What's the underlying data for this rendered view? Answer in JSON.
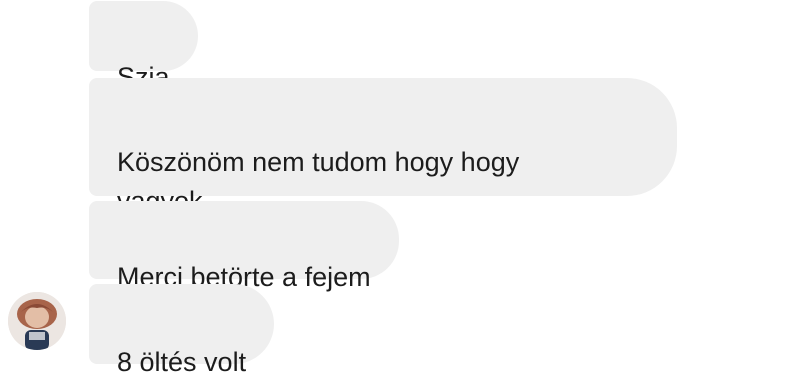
{
  "messages": [
    {
      "text": "Szia"
    },
    {
      "text": "Köszönöm nem tudom hogy hogy\nvagyok"
    },
    {
      "text": "Merci betörte a fejem"
    },
    {
      "text": "8 öltés volt"
    }
  ],
  "colors": {
    "bubble_bg": "#efefef",
    "text": "#1c1c1c",
    "background": "#ffffff"
  },
  "avatar": {
    "icon": "profile-photo"
  }
}
